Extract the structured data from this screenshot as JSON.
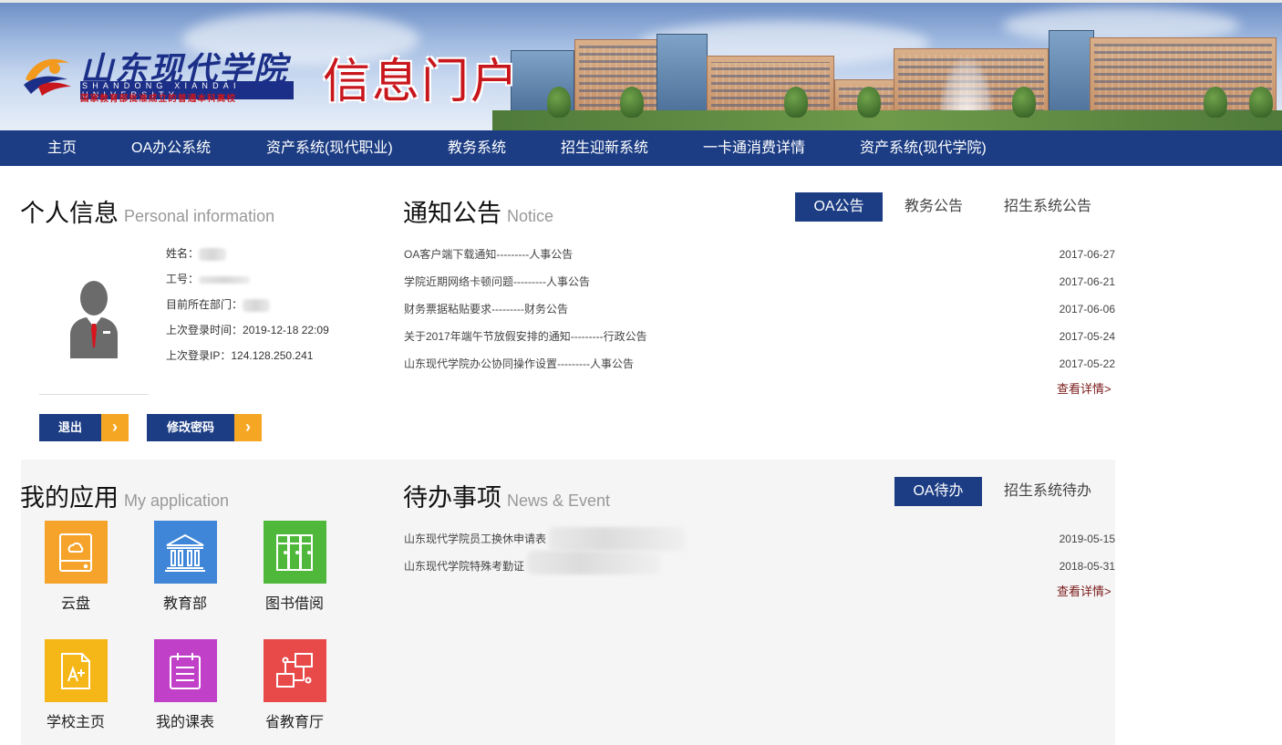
{
  "header": {
    "logo_cn": "山东现代学院",
    "logo_en": "SHANDONG XIANDAI UNIVERSITY",
    "logo_sub": "国家教育部批准成立的普通本科高校",
    "portal_title": "信息门户"
  },
  "nav": [
    "主页",
    "OA办公系统",
    "资产系统(现代职业)",
    "教务系统",
    "招生迎新系统",
    "一卡通消费详情",
    "资产系统(现代学院)"
  ],
  "personal": {
    "title_cn": "个人信息",
    "title_en": "Personal information",
    "name_label": "姓名：",
    "id_label": "工号：",
    "dept_label": "目前所在部门：",
    "last_login_label": "上次登录时间：",
    "last_login_value": "2019-12-18 22:09",
    "last_ip_label": "上次登录IP：",
    "last_ip_value": "124.128.250.241",
    "logout_label": "退出",
    "change_pwd_label": "修改密码"
  },
  "notice": {
    "title_cn": "通知公告",
    "title_en": "Notice",
    "tabs": [
      "OA公告",
      "教务公告",
      "招生系统公告"
    ],
    "active_tab": "OA公告",
    "items": [
      {
        "text": "OA客户端下载通知---------人事公告",
        "date": "2017-06-27"
      },
      {
        "text": "学院近期网络卡顿问题---------人事公告",
        "date": "2017-06-21"
      },
      {
        "text": "财务票据粘贴要求---------财务公告",
        "date": "2017-06-06"
      },
      {
        "text": "关于2017年端午节放假安排的通知---------行政公告",
        "date": "2017-05-24"
      },
      {
        "text": "山东现代学院办公协同操作设置---------人事公告",
        "date": "2017-05-22"
      }
    ],
    "more": "查看详情>"
  },
  "apps": {
    "title_cn": "我的应用",
    "title_en": "My application",
    "items": [
      {
        "name": "云盘",
        "icon": "cloud-drive-icon",
        "color": "#f5a32a"
      },
      {
        "name": "教育部",
        "icon": "government-building-icon",
        "color": "#3f86d8"
      },
      {
        "name": "图书借阅",
        "icon": "bookshelf-icon",
        "color": "#4fb83a"
      },
      {
        "name": "学校主页",
        "icon": "document-plus-icon",
        "color": "#f5b617"
      },
      {
        "name": "我的课表",
        "icon": "schedule-list-icon",
        "color": "#c040c8"
      },
      {
        "name": "省教育厅",
        "icon": "network-icon",
        "color": "#e84a4a"
      }
    ]
  },
  "todo": {
    "title_cn": "待办事项",
    "title_en": "News & Event",
    "tabs": [
      "OA待办",
      "招生系统待办"
    ],
    "active_tab": "OA待办",
    "items": [
      {
        "text": "山东现代学院员工换休申请表",
        "date": "2019-05-15"
      },
      {
        "text": "山东现代学院特殊考勤证",
        "date": "2018-05-31"
      }
    ],
    "more": "查看详情>"
  },
  "colors": {
    "nav_bg": "#1c3d84",
    "accent_orange": "#f5a623",
    "title_red": "#c8161d"
  }
}
